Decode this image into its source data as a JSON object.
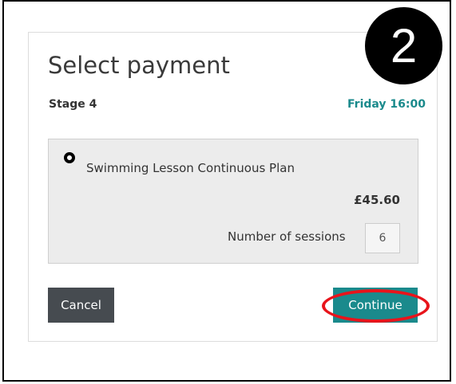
{
  "step_badge": "2",
  "header": {
    "title": "Select payment",
    "stage": "Stage 4",
    "datetime": "Friday 16:00"
  },
  "option": {
    "name": "Swimming Lesson Continuous Plan",
    "price": "£45.60",
    "sessions_label": "Number of sessions",
    "sessions_value": "6",
    "selected": true
  },
  "actions": {
    "cancel_label": "Cancel",
    "continue_label": "Continue"
  },
  "colors": {
    "accent": "#1a8a8c",
    "cancel_bg": "#464b50",
    "highlight": "#e8141b",
    "panel_bg": "#ececec"
  }
}
